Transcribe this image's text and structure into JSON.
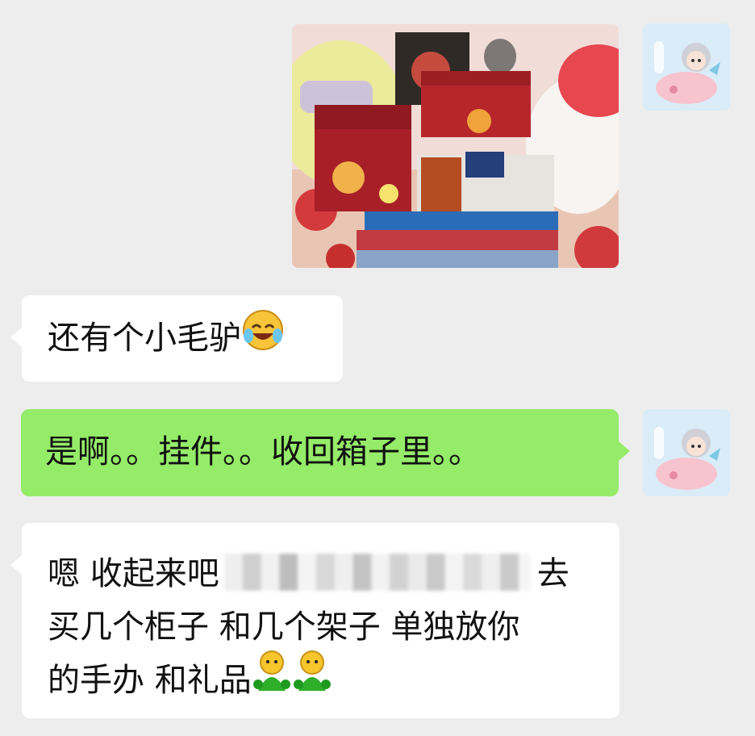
{
  "chat": {
    "messages": [
      {
        "side": "right",
        "type": "image",
        "alt": ""
      },
      {
        "side": "left",
        "type": "text",
        "text": "还有个小毛驴",
        "emoji": "laughing-tears-emoji"
      },
      {
        "side": "right",
        "type": "text",
        "text": "是啊。。挂件。。收回箱子里。。"
      },
      {
        "side": "left",
        "type": "text",
        "lines": [
          {
            "before": "嗯 收起来吧",
            "after": "去"
          },
          {
            "text": "买几个柜子 和几个架子 单独放你"
          },
          {
            "text": "的手办 和礼品"
          }
        ],
        "emoji": [
          "green-doll-emoji",
          "green-doll-emoji"
        ]
      }
    ]
  },
  "colors": {
    "background": "#ededed",
    "bubble_in": "#ffffff",
    "bubble_out": "#95ec69"
  },
  "icons": {
    "avatar": "cartoon-pig-rider-avatar"
  }
}
